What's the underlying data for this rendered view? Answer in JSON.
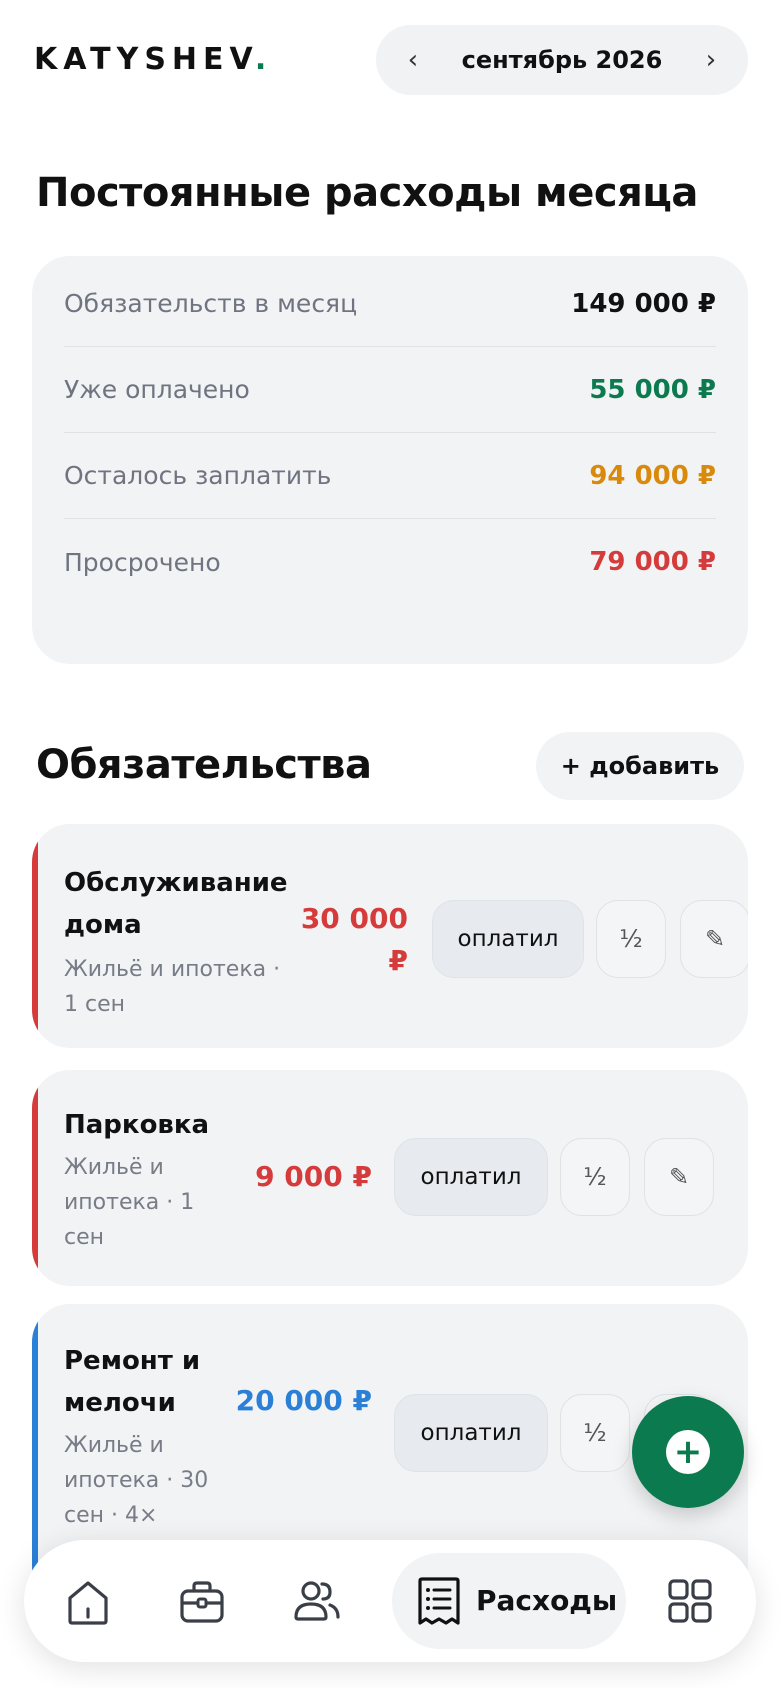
{
  "header": {
    "logo": "KATYSHEV",
    "logo_dot": ".",
    "month": "сентябрь 2026",
    "prev_icon": "‹",
    "next_icon": "›"
  },
  "summary": {
    "title": "Постоянные расходы месяца",
    "rows": [
      {
        "label": "Обязательств в месяц",
        "value": "149 000 ₽",
        "color": "#111111"
      },
      {
        "label": "Уже оплачено",
        "value": "55 000 ₽",
        "color": "#0b7a4e"
      },
      {
        "label": "Осталось заплатить",
        "value": "94 000 ₽",
        "color": "#d98a0b"
      },
      {
        "label": "Просрочено",
        "value": "79 000 ₽",
        "color": "#d63b3b"
      }
    ]
  },
  "obligations": {
    "title": "Обязательства",
    "add_label": "+ добавить",
    "items": [
      {
        "title_1": "Обслуживание",
        "title_2": "дома",
        "sub_1": "Жильё и ипотека ·",
        "sub_2": "1 сен",
        "sub_3": "",
        "amount_1": "30 000",
        "amount_2": "₽",
        "accent": "#d63b3b",
        "paid_label": "оплатил",
        "half_label": "½",
        "edit_icon": "✎"
      },
      {
        "title_1": "Парковка",
        "title_2": "",
        "sub_1": "Жильё и",
        "sub_2": "ипотека · 1",
        "sub_3": "сен",
        "amount_1": "9 000 ₽",
        "amount_2": "",
        "accent": "#d63b3b",
        "paid_label": "оплатил",
        "half_label": "½",
        "edit_icon": "✎"
      },
      {
        "title_1": "Ремонт и",
        "title_2": "мелочи",
        "sub_1": "Жильё и",
        "sub_2": "ипотека · 30",
        "sub_3": "сен · 4×",
        "amount_1": "20 000 ₽",
        "amount_2": "",
        "accent": "#2a7fd6",
        "paid_label": "оплатил",
        "half_label": "½",
        "edit_icon": "✎"
      }
    ]
  },
  "fab": {
    "icon": "+"
  },
  "nav": {
    "items": [
      {
        "icon": "home-icon"
      },
      {
        "icon": "briefcase-icon"
      },
      {
        "icon": "people-icon"
      },
      {
        "icon": "receipt-icon",
        "label": "Расходы",
        "active": true
      },
      {
        "icon": "grid-icon"
      }
    ]
  }
}
